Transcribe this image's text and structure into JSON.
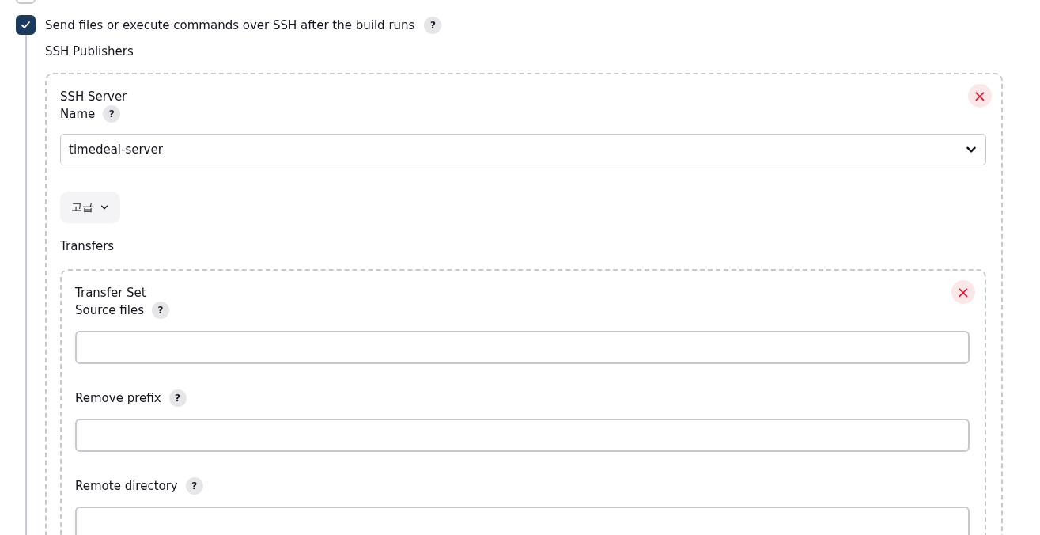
{
  "previous_option": {
    "checked": false
  },
  "option": {
    "label": "Send files or execute commands over SSH after the build runs",
    "help": "?",
    "checked": true
  },
  "section_title": "SSH Publishers",
  "server": {
    "title": "SSH Server",
    "close": "×",
    "name_label": "Name",
    "name_help": "?",
    "name_value": "timedeal-server",
    "advanced": "고급",
    "transfers_label": "Transfers",
    "transfer_set": {
      "title": "Transfer Set",
      "close": "×",
      "fields": [
        {
          "label": "Source files",
          "help": "?"
        },
        {
          "label": "Remove prefix",
          "help": "?"
        },
        {
          "label": "Remote directory",
          "help": "?"
        }
      ]
    }
  }
}
